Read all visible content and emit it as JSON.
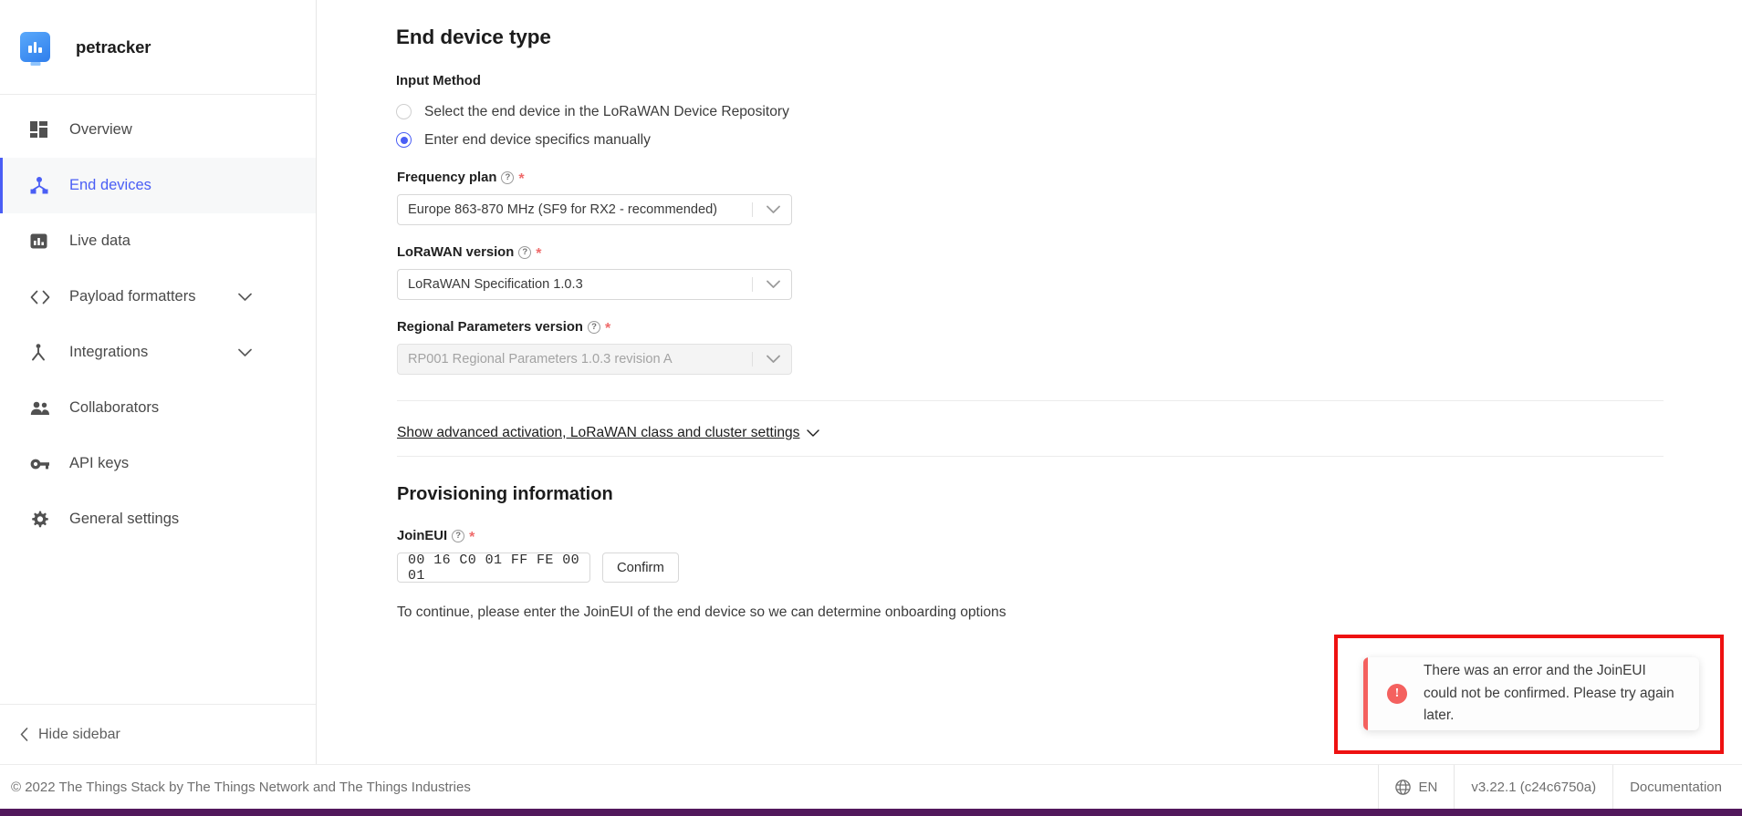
{
  "brand": {
    "name": "petracker",
    "logo_icon": "monitor-chart-icon"
  },
  "sidebar": {
    "items": [
      {
        "label": "Overview",
        "icon": "grid-icon",
        "active": false,
        "expandable": false
      },
      {
        "label": "End devices",
        "icon": "device-tree-icon",
        "active": true,
        "expandable": false
      },
      {
        "label": "Live data",
        "icon": "bar-chart-icon",
        "active": false,
        "expandable": false
      },
      {
        "label": "Payload formatters",
        "icon": "code-brackets-icon",
        "active": false,
        "expandable": true
      },
      {
        "label": "Integrations",
        "icon": "integration-icon",
        "active": false,
        "expandable": true
      },
      {
        "label": "Collaborators",
        "icon": "people-icon",
        "active": false,
        "expandable": false
      },
      {
        "label": "API keys",
        "icon": "key-icon",
        "active": false,
        "expandable": false
      },
      {
        "label": "General settings",
        "icon": "gear-icon",
        "active": false,
        "expandable": false
      }
    ],
    "hide_sidebar_label": "Hide sidebar",
    "hide_sidebar_icon": "chevron-left-icon"
  },
  "main": {
    "section_title": "End device type",
    "input_method": {
      "label": "Input Method",
      "options": [
        {
          "label": "Select the end device in the LoRaWAN Device Repository",
          "selected": false
        },
        {
          "label": "Enter end device specifics manually",
          "selected": true
        }
      ]
    },
    "frequency_plan": {
      "label": "Frequency plan",
      "required_marker": "*",
      "help_icon": "question-circle-icon",
      "value": "Europe 863-870 MHz (SF9 for RX2 - recommended)",
      "disabled": false
    },
    "lorawan_version": {
      "label": "LoRaWAN version",
      "required_marker": "*",
      "help_icon": "question-circle-icon",
      "value": "LoRaWAN Specification 1.0.3",
      "disabled": false
    },
    "regional_parameters": {
      "label": "Regional Parameters version",
      "required_marker": "*",
      "help_icon": "question-circle-icon",
      "value": "RP001 Regional Parameters 1.0.3 revision A",
      "disabled": true
    },
    "advanced_link": {
      "label": "Show advanced activation, LoRaWAN class and cluster settings",
      "icon": "chevron-down-icon"
    },
    "provisioning": {
      "title": "Provisioning information",
      "joineui": {
        "label": "JoinEUI",
        "required_marker": "*",
        "help_icon": "question-circle-icon",
        "value": "00 16 C0 01 FF FE 00 01",
        "confirm_label": "Confirm"
      },
      "hint": "To continue, please enter the JoinEUI of the end device so we can determine onboarding options"
    }
  },
  "toast": {
    "icon": "error-exclamation-icon",
    "message": "There was an error and the JoinEUI could not be confirmed. Please try again later.",
    "accent_color": "#f4615f",
    "highlight_color": "#ee1111"
  },
  "footer": {
    "copyright": "© 2022 The Things Stack by The Things Network and The Things Industries",
    "language": {
      "icon": "globe-icon",
      "label": "EN"
    },
    "version": "v3.22.1 (c24c6750a)",
    "documentation": "Documentation",
    "bar_color": "#52185c"
  }
}
